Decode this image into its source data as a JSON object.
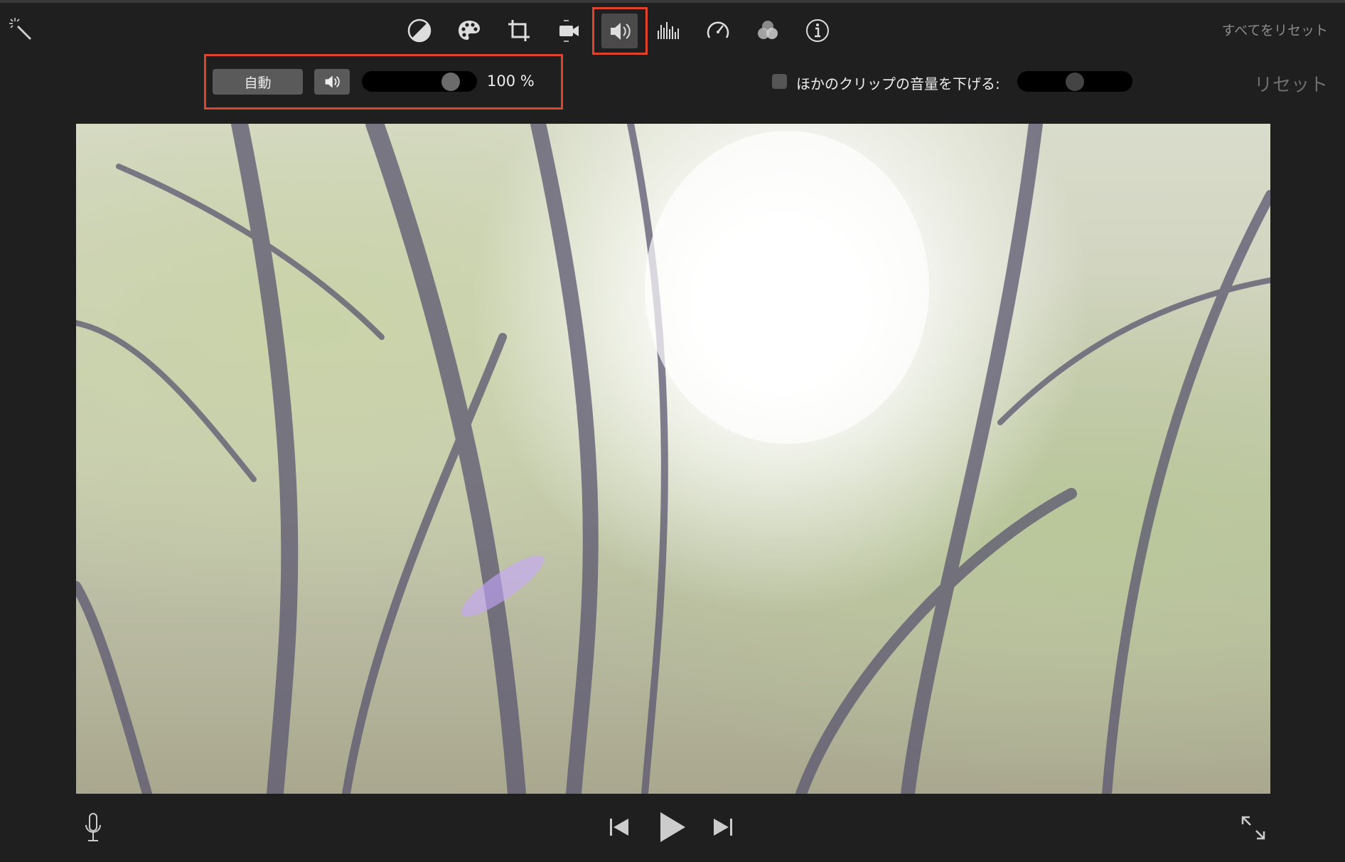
{
  "toolbar": {
    "tools": [
      {
        "icon": "magic-wand-icon"
      },
      {
        "icon": "color-balance-icon"
      },
      {
        "icon": "color-palette-icon"
      },
      {
        "icon": "crop-icon"
      },
      {
        "icon": "stabilization-camera-icon"
      },
      {
        "icon": "volume-icon",
        "selected": true
      },
      {
        "icon": "noise-equalizer-icon"
      },
      {
        "icon": "speed-icon"
      },
      {
        "icon": "clip-filter-icon"
      },
      {
        "icon": "info-icon"
      }
    ],
    "reset_all_label": "すべてをリセット"
  },
  "volume": {
    "auto_label": "自動",
    "mute_icon": "speaker-icon",
    "level_percent": 100,
    "level_text": "100 %",
    "duck_checkbox_checked": false,
    "duck_label": "ほかのクリップの音量を下げる:",
    "duck_level_percent": 50,
    "reset_label": "リセット"
  },
  "colors": {
    "highlight": "#e0432b",
    "background": "#1f1f1f"
  },
  "playback": {
    "icons": [
      "microphone-icon",
      "skip-back-icon",
      "play-icon",
      "skip-forward-icon",
      "fullscreen-icon"
    ]
  }
}
